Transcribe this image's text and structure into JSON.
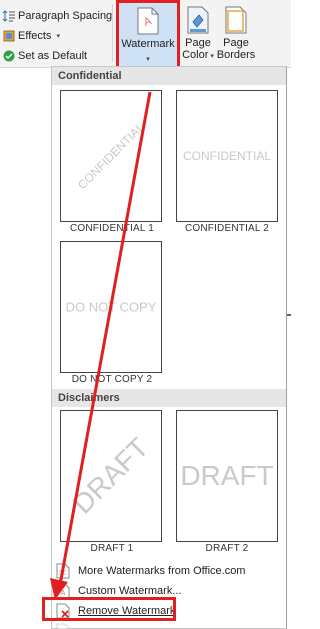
{
  "ribbon": {
    "paragraph_spacing": "Paragraph Spacing",
    "effects": "Effects",
    "set_default": "Set as Default",
    "watermark": "Watermark",
    "page_color_line1": "Page",
    "page_color_line2": "Color",
    "page_borders_line1": "Page",
    "page_borders_line2": "Borders"
  },
  "gallery": {
    "sections": [
      {
        "header": "Confidential",
        "items": [
          {
            "label": "CONFIDENTIAL 1",
            "watermark_text": "CONFIDENTIAL",
            "style": "diagonal"
          },
          {
            "label": "CONFIDENTIAL 2",
            "watermark_text": "CONFIDENTIAL",
            "style": "horizontal"
          },
          {
            "label": "DO NOT COPY 2",
            "watermark_text": "DO NOT COPY",
            "style": "horizontal"
          }
        ]
      },
      {
        "header": "Disclaimers",
        "items": [
          {
            "label": "DRAFT 1",
            "watermark_text": "DRAFT",
            "style": "diagonal"
          },
          {
            "label": "DRAFT 2",
            "watermark_text": "DRAFT",
            "style": "horizontal"
          }
        ]
      }
    ]
  },
  "menu": {
    "more_watermarks": "More Watermarks from Office.com",
    "custom_watermark": "Custom Watermark...",
    "remove_watermark": "Remove Watermark"
  },
  "colors": {
    "highlight_red": "#e02020",
    "selected_button": "#cfe2f5",
    "watermark_gray": "#c9c9c9"
  }
}
